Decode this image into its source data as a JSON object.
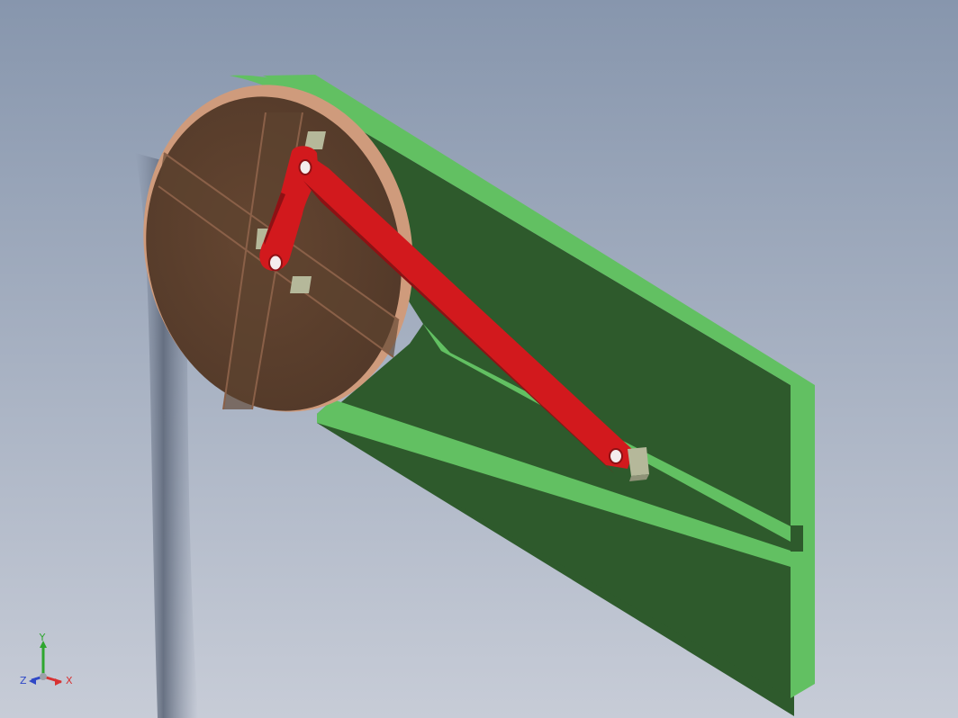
{
  "viewport": {
    "background_top": "#8796ad",
    "background_bottom": "#c7ccd7"
  },
  "model": {
    "base_plate_color": "#2e5a2c",
    "base_plate_edge_color": "#62c062",
    "disk_color": "#563c2b",
    "disk_edge_color": "#cf9b7c",
    "link_color": "#d2191d",
    "link_shadow_color": "#8e1114",
    "slider_color": "#b5b89a"
  },
  "triad": {
    "x_label": "X",
    "y_label": "Y",
    "z_label": "Z",
    "x_color": "#d73232",
    "y_color": "#2fa62f",
    "z_color": "#2f48c6"
  }
}
